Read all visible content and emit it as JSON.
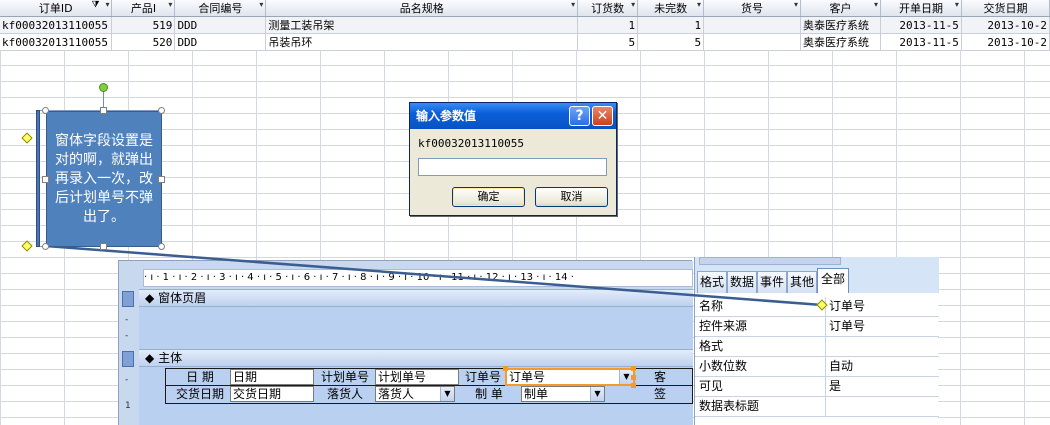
{
  "datasheet": {
    "columns": [
      {
        "label": "订单ID",
        "filter": true
      },
      {
        "label": "产品I",
        "filter": false
      },
      {
        "label": "合同编号",
        "filter": false
      },
      {
        "label": "品名规格",
        "filter": false
      },
      {
        "label": "订货数",
        "filter": false
      },
      {
        "label": "未完数",
        "filter": false
      },
      {
        "label": "货号",
        "filter": false
      },
      {
        "label": "客户",
        "filter": false
      },
      {
        "label": "开单日期",
        "filter": false
      },
      {
        "label": "交货日期",
        "filter": false
      }
    ],
    "rows": [
      [
        "kf00032013110055",
        "519",
        "DDD",
        "测量工装吊架",
        "1",
        "1",
        "",
        "奥泰医疗系统",
        "2013-11-5",
        "2013-10-2"
      ],
      [
        "kf00032013110055",
        "520",
        "DDD",
        "吊装吊环",
        "5",
        "5",
        "",
        "奥泰医疗系统",
        "2013-11-5",
        "2013-10-2"
      ]
    ]
  },
  "callout": {
    "text": "窗体字段设置是对的啊，就弹出再录入一次，改后计划单号不弹出了。"
  },
  "dialog": {
    "title": "输入参数值",
    "help_label": "?",
    "close_label": "✕",
    "prompt": "kf00032013110055",
    "value": "",
    "ok_label": "确定",
    "cancel_label": "取消"
  },
  "designer": {
    "ruler": "· ı · 1 · ı · 2 · ı · 3 · ı · 4 · ı · 5 · ı · 6 · ı · 7 · ı · 8 · ı · 9 · ı · 10 · ı · 11 · ı · 12 · ı · 13 · ı · 14 ·",
    "vruler_marks": [
      "-",
      "-",
      "-",
      "1"
    ],
    "header_band": "窗体页眉",
    "detail_band": "主体",
    "band_icon": "◆",
    "controls": {
      "date_label": "日    期",
      "date_value": "日期",
      "plan_label": "计划单号",
      "plan_value": "计划单号",
      "order_label": "订单号",
      "order_value": "订单号",
      "cust_label": "客",
      "due_label": "交货日期",
      "due_value": "交货日期",
      "recv_label": "落货人",
      "recv_value": "落货人",
      "maker_label": "制    单",
      "maker_value": "制单",
      "sign_label": "签"
    }
  },
  "properties": {
    "tabs": [
      "格式",
      "数据",
      "事件",
      "其他",
      "全部"
    ],
    "active_tab": "全部",
    "rows": [
      {
        "key": "名称",
        "value": "订单号"
      },
      {
        "key": "控件来源",
        "value": "订单号"
      },
      {
        "key": "格式",
        "value": ""
      },
      {
        "key": "小数位数",
        "value": "自动"
      },
      {
        "key": "可见",
        "value": "是"
      },
      {
        "key": "数据表标题",
        "value": ""
      }
    ]
  },
  "colors": {
    "callout": "#4f81bd",
    "dialog_title": "#0a5fd8",
    "selection": "#f19b2c",
    "band": "#b9d0f0"
  }
}
